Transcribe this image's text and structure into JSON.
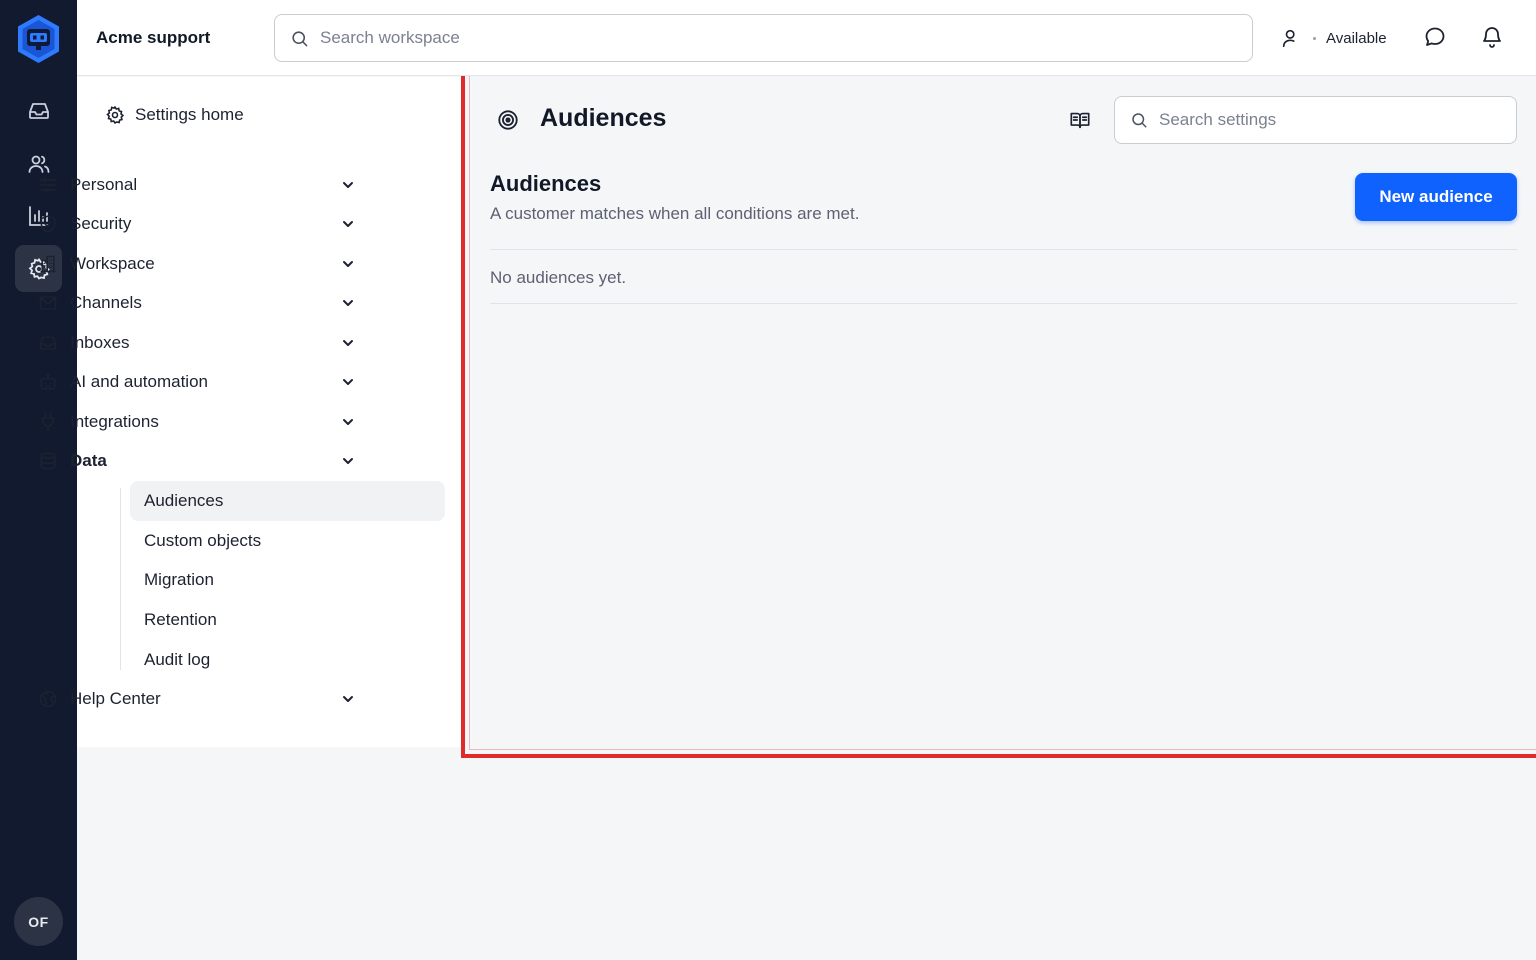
{
  "colors": {
    "rail_bg": "#121a30",
    "accent": "#0f62fe",
    "highlight_border": "#e02b2b"
  },
  "rail": {
    "logo_icon": "hexagon-bot-logo",
    "items": [
      {
        "name": "inbox-icon",
        "active": false
      },
      {
        "name": "people-icon",
        "active": false
      },
      {
        "name": "reports-icon",
        "active": false
      },
      {
        "name": "gear-icon",
        "active": true
      }
    ],
    "avatar_initials": "OF"
  },
  "topbar": {
    "brand": "Acme support",
    "search_placeholder": "Search workspace",
    "status_label": "Available"
  },
  "nav": {
    "home_label": "Settings home",
    "sections": [
      {
        "label": "Personal",
        "icon": "sliders-icon"
      },
      {
        "label": "Security",
        "icon": "shield-icon"
      },
      {
        "label": "Workspace",
        "icon": "building-icon"
      },
      {
        "label": "Channels",
        "icon": "envelope-icon"
      },
      {
        "label": "Inboxes",
        "icon": "inbox-icon"
      },
      {
        "label": "AI and automation",
        "icon": "robot-icon"
      },
      {
        "label": "Integrations",
        "icon": "plug-icon"
      },
      {
        "label": "Data",
        "icon": "database-icon"
      },
      {
        "label": "Help Center",
        "icon": "globe-icon"
      }
    ],
    "data_children": [
      "Audiences",
      "Custom objects",
      "Migration",
      "Retention",
      "Audit log"
    ],
    "active_child": "Audiences"
  },
  "page": {
    "title": "Audiences",
    "search_placeholder": "Search settings",
    "section_title": "Audiences",
    "section_subtitle": "A customer matches when all conditions are met.",
    "new_button": "New audience",
    "empty_text": "No audiences yet."
  }
}
